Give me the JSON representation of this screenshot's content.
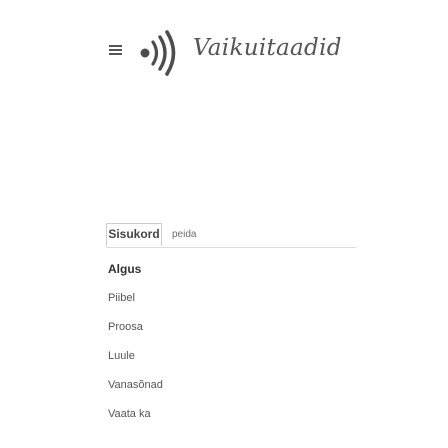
{
  "header": {
    "site_name": "Vaikuitaadid",
    "logo_icon": "sound-waves-icon",
    "menu_icon": "hamburger-menu-icon"
  },
  "tabs": {
    "active_label": "Sisukord",
    "inactive_label": "peida"
  },
  "nav": {
    "heading": "Algus",
    "items": [
      "Piibel",
      "Proosa",
      "Luule",
      "Vanasõnad",
      "Vaata ka"
    ]
  },
  "colors": {
    "text": "#555555",
    "border": "#cccccc",
    "background": "#ffffff"
  }
}
